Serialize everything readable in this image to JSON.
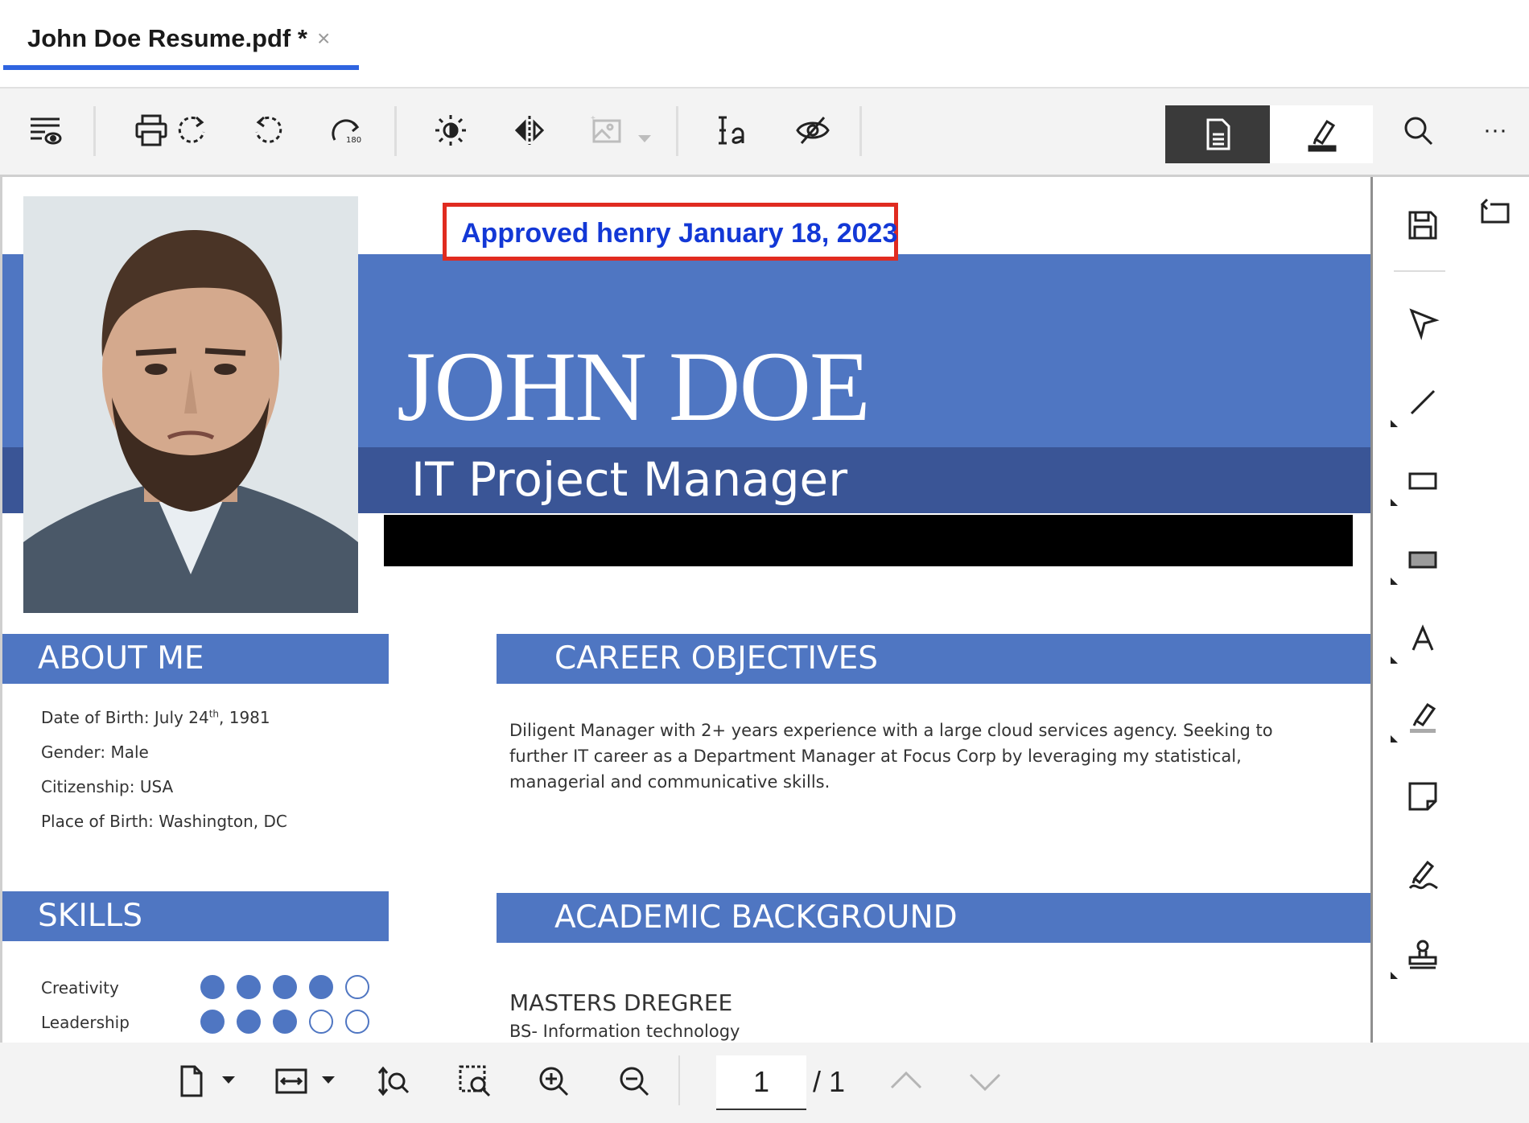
{
  "tab": {
    "title": "John Doe Resume.pdf *",
    "close": "×"
  },
  "icons": {
    "toolbar": [
      "view-settings-icon",
      "print-icon",
      "rotate-page-icon",
      "rotate-left-icon",
      "rotate-180-icon",
      "brightness-icon",
      "flip-horizontal-icon",
      "image-icon",
      "text-field-icon",
      "hide-icon",
      "document-view-icon",
      "annotate-icon",
      "search-icon",
      "more-icon"
    ],
    "rail": [
      "save-icon",
      "select-arrow-icon",
      "line-icon",
      "rectangle-icon",
      "filled-rectangle-icon",
      "text-icon",
      "highlight-icon",
      "sticky-note-icon",
      "signature-icon",
      "stamp-icon",
      "collapse-panel-icon"
    ],
    "bottom": [
      "page-layout-icon",
      "fit-width-icon",
      "zoom-tool-icon",
      "marquee-zoom-icon",
      "zoom-in-icon",
      "zoom-out-icon",
      "previous-page-icon",
      "next-page-icon"
    ]
  },
  "toolbar": {
    "more_label": "···"
  },
  "colors": {
    "accent": "#2f64e0",
    "resume_blue": "#4f76c2",
    "resume_dark_blue": "#3a5596",
    "stamp_border": "#e02b20",
    "stamp_text": "#1338d6"
  },
  "stamp": {
    "text": "Approved henry January 18, 2023"
  },
  "resume": {
    "name": "JOHN DOE",
    "role": "IT Project Manager",
    "about": {
      "heading": "ABOUT ME",
      "dob_prefix": "Date of Birth: July 24",
      "dob_sup": "th",
      "dob_suffix": ", 1981",
      "gender": "Gender: Male",
      "citizenship": "Citizenship: USA",
      "birthplace": "Place of Birth: Washington, DC"
    },
    "career": {
      "heading": "CAREER OBJECTIVES",
      "text": "Diligent Manager with 2+ years experience with a large cloud services agency. Seeking to further IT career as a Department Manager at Focus Corp  by leveraging my statistical, managerial and communicative skills."
    },
    "skills": {
      "heading": "SKILLS",
      "items": [
        {
          "label": "Creativity",
          "rating": 4,
          "max": 5
        },
        {
          "label": "Leadership",
          "rating": 3,
          "max": 5
        }
      ]
    },
    "academic": {
      "heading": "ACADEMIC BACKGROUND",
      "degree": "MASTERS DREGREE",
      "sub": "BS- Information technology"
    }
  },
  "pagination": {
    "current": "1",
    "total": "/ 1"
  }
}
